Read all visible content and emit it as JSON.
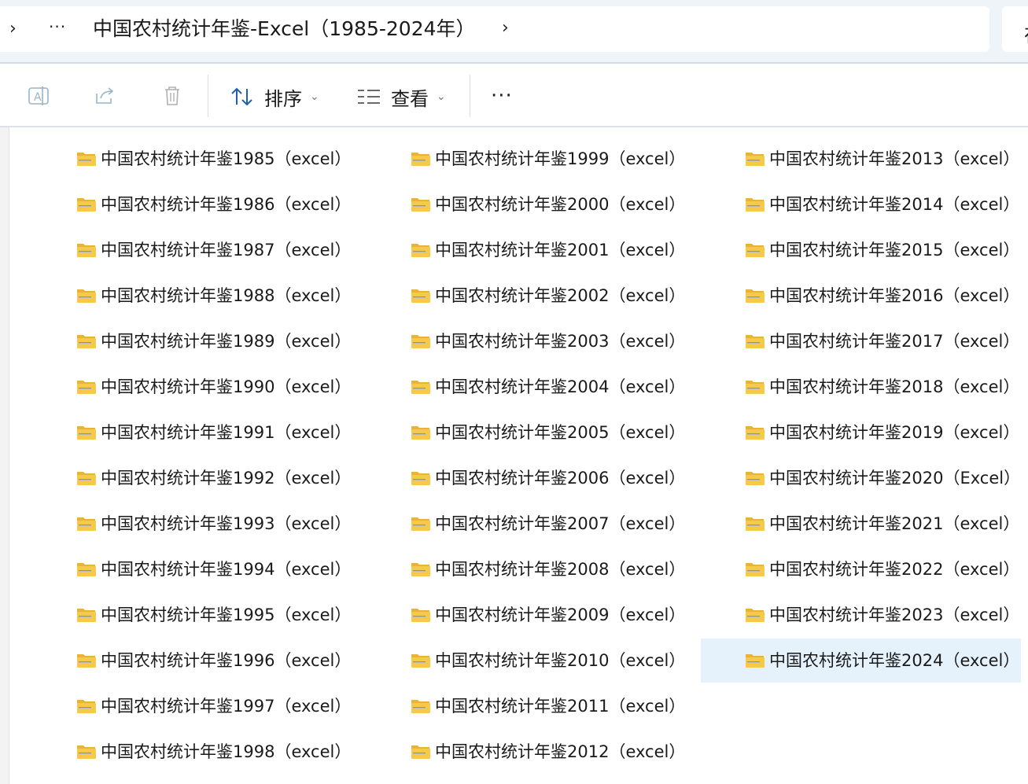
{
  "address_bar": {
    "nav_chevron": "›",
    "more": "···",
    "breadcrumb": "中国农村统计年鉴-Excel（1985-2024年）",
    "breadcrumb_arrow": "›",
    "search_text": "在"
  },
  "toolbar": {
    "sort_label": "排序",
    "view_label": "查看",
    "more": "···"
  },
  "folders": [
    "中国农村统计年鉴1985（excel）",
    "中国农村统计年鉴1986（excel）",
    "中国农村统计年鉴1987（excel）",
    "中国农村统计年鉴1988（excel）",
    "中国农村统计年鉴1989（excel）",
    "中国农村统计年鉴1990（excel）",
    "中国农村统计年鉴1991（excel）",
    "中国农村统计年鉴1992（excel）",
    "中国农村统计年鉴1993（excel）",
    "中国农村统计年鉴1994（excel）",
    "中国农村统计年鉴1995（excel）",
    "中国农村统计年鉴1996（excel）",
    "中国农村统计年鉴1997（excel）",
    "中国农村统计年鉴1998（excel）",
    "中国农村统计年鉴1999（excel）",
    "中国农村统计年鉴2000（excel）",
    "中国农村统计年鉴2001（excel）",
    "中国农村统计年鉴2002（excel）",
    "中国农村统计年鉴2003（excel）",
    "中国农村统计年鉴2004（excel）",
    "中国农村统计年鉴2005（excel）",
    "中国农村统计年鉴2006（excel）",
    "中国农村统计年鉴2007（excel）",
    "中国农村统计年鉴2008（excel）",
    "中国农村统计年鉴2009（excel）",
    "中国农村统计年鉴2010（excel）",
    "中国农村统计年鉴2011（excel）",
    "中国农村统计年鉴2012（excel）",
    "中国农村统计年鉴2013（excel）",
    "中国农村统计年鉴2014（excel）",
    "中国农村统计年鉴2015（excel）",
    "中国农村统计年鉴2016（excel）",
    "中国农村统计年鉴2017（excel）",
    "中国农村统计年鉴2018（excel）",
    "中国农村统计年鉴2019（excel）",
    "中国农村统计年鉴2020（Excel）",
    "中国农村统计年鉴2021（excel）",
    "中国农村统计年鉴2022（excel）",
    "中国农村统计年鉴2023（excel）",
    "中国农村统计年鉴2024（excel）"
  ],
  "selected_folder": "中国农村统计年鉴2024（excel）",
  "colors": {
    "selection": "#e5f1fb",
    "folder": "#f7c948",
    "address_bg": "#eff4f9"
  }
}
